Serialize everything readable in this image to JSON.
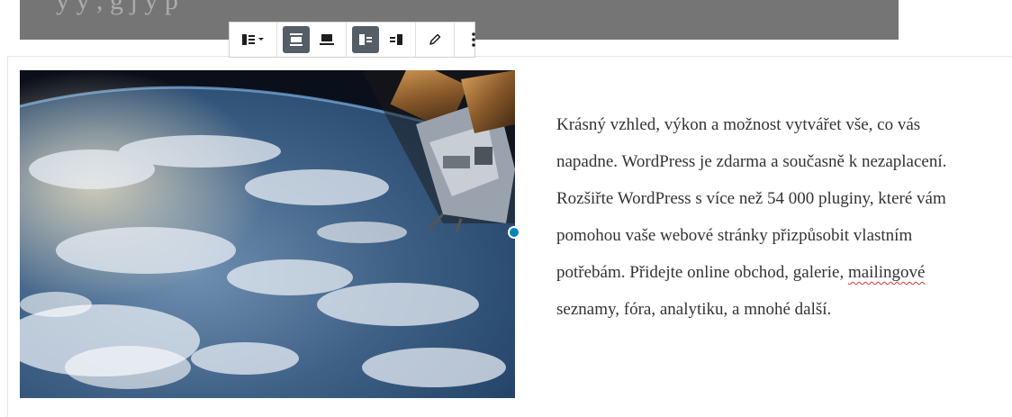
{
  "banner": {
    "text": "y       y                ,      g        j   y   p"
  },
  "toolbar": {
    "buttons": [
      {
        "name": "change-alignment-button",
        "icon": "align-dropdown-icon"
      },
      {
        "name": "wide-width-button",
        "icon": "wide-width-icon"
      },
      {
        "name": "full-width-button",
        "icon": "full-width-icon"
      },
      {
        "name": "media-left-button",
        "icon": "media-left-icon"
      },
      {
        "name": "media-right-button",
        "icon": "media-right-icon"
      },
      {
        "name": "edit-button",
        "icon": "pencil-icon"
      },
      {
        "name": "more-options-button",
        "icon": "kebab-icon"
      }
    ],
    "active_color": "#555d66"
  },
  "content": {
    "p1": "Krásný vzhled, výkon a možnost vytvářet vše, co vás napadne. WordPress je zdarma a současně k nezaplacení. Rozšiřte WordPress s více než 54 000 pluginy, které vám pomohou vaše webové stránky přizpůsobit vlastním potřebám. Přidejte online obchod, galerie, ",
    "misspelled": "mailingové",
    "p2": " seznamy, fóra, analytiku, a mnohé další."
  },
  "colors": {
    "handle": "#0085ba",
    "banner": "#757575"
  }
}
